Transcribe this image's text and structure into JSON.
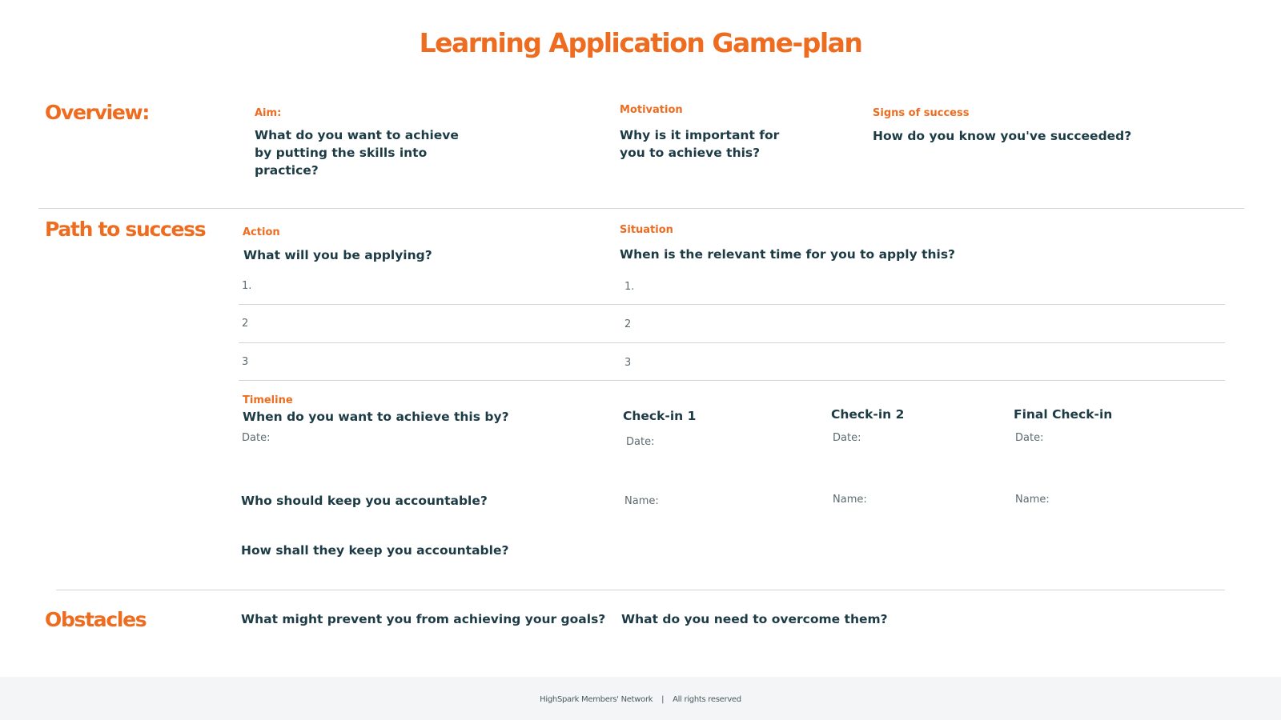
{
  "title": "Learning Application Game-plan",
  "overview": {
    "heading": "Overview:",
    "aim": {
      "label": "Aim:",
      "question": "What do you want to achieve by putting the skills into practice?"
    },
    "motivation": {
      "label": "Motivation",
      "question": "Why is it important for you to achieve this?"
    },
    "signs": {
      "label": "Signs of success",
      "question": "How do you know you've succeeded?"
    }
  },
  "path": {
    "heading": "Path to success",
    "action": {
      "label": "Action",
      "question": "What will you be applying?",
      "rows": [
        "1.",
        "2",
        "3"
      ]
    },
    "situation": {
      "label": "Situation",
      "question": "When is the relevant time for you to apply this?",
      "rows": [
        "1.",
        "2",
        "3"
      ]
    },
    "timeline": {
      "label": "Timeline",
      "question": "When do you want to achieve this by?",
      "date_label": "Date:"
    },
    "checkins": [
      {
        "title": "Check-in 1",
        "date_label": "Date:",
        "name_label": "Name:"
      },
      {
        "title": "Check-in 2",
        "date_label": "Date:",
        "name_label": "Name:"
      },
      {
        "title": "Final Check-in",
        "date_label": "Date:",
        "name_label": "Name:"
      }
    ],
    "accountable_who": "Who should keep you accountable?",
    "accountable_how": "How shall they keep you accountable?"
  },
  "obstacles": {
    "heading": "Obstacles",
    "prevent": "What might prevent you from achieving your goals?",
    "overcome": "What do you need to overcome them?"
  },
  "footer": {
    "network": "HighSpark Members' Network",
    "separator": "|",
    "rights": "All rights reserved"
  }
}
